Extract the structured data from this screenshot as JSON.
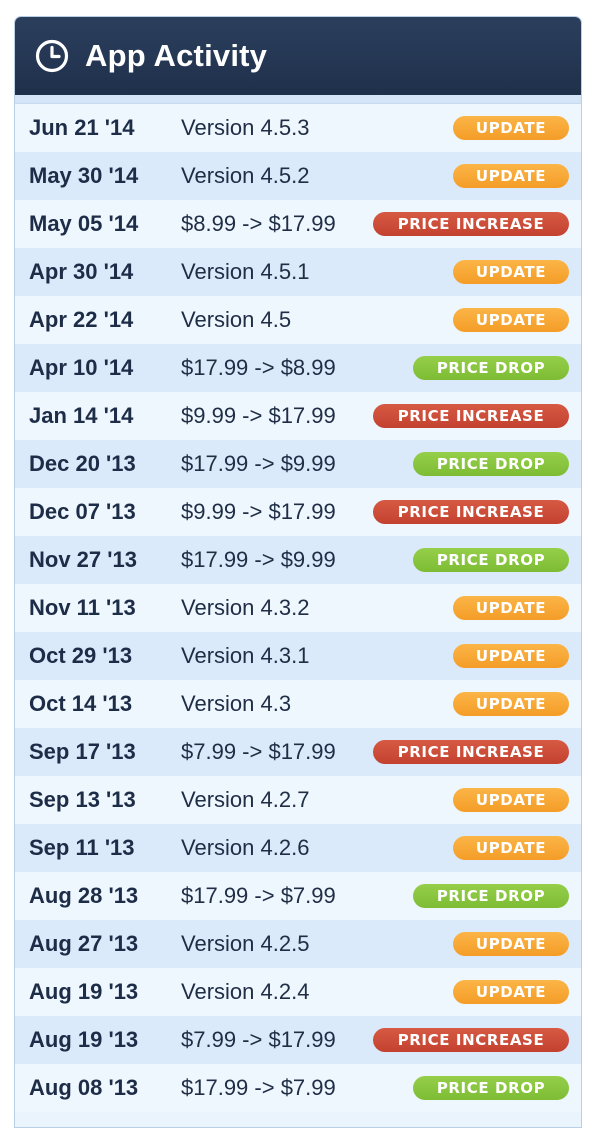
{
  "header": {
    "title": "App Activity",
    "icon": "clock-icon"
  },
  "colors": {
    "header_bg": "#233654",
    "update": "#f7a833",
    "price_increase": "#cc4c39",
    "price_drop": "#86c43d"
  },
  "activity": [
    {
      "date": "Jun 21 '14",
      "detail": "Version 4.5.3",
      "type": "update",
      "badge": "UPDATE"
    },
    {
      "date": "May 30 '14",
      "detail": "Version 4.5.2",
      "type": "update",
      "badge": "UPDATE"
    },
    {
      "date": "May 05 '14",
      "detail": "$8.99 -> $17.99",
      "type": "increase",
      "badge": "PRICE INCREASE"
    },
    {
      "date": "Apr 30 '14",
      "detail": "Version 4.5.1",
      "type": "update",
      "badge": "UPDATE"
    },
    {
      "date": "Apr 22 '14",
      "detail": "Version 4.5",
      "type": "update",
      "badge": "UPDATE"
    },
    {
      "date": "Apr 10 '14",
      "detail": "$17.99 -> $8.99",
      "type": "drop",
      "badge": "PRICE DROP"
    },
    {
      "date": "Jan 14 '14",
      "detail": "$9.99 -> $17.99",
      "type": "increase",
      "badge": "PRICE INCREASE"
    },
    {
      "date": "Dec 20 '13",
      "detail": "$17.99 -> $9.99",
      "type": "drop",
      "badge": "PRICE DROP"
    },
    {
      "date": "Dec 07 '13",
      "detail": "$9.99 -> $17.99",
      "type": "increase",
      "badge": "PRICE INCREASE"
    },
    {
      "date": "Nov 27 '13",
      "detail": "$17.99 -> $9.99",
      "type": "drop",
      "badge": "PRICE DROP"
    },
    {
      "date": "Nov 11 '13",
      "detail": "Version 4.3.2",
      "type": "update",
      "badge": "UPDATE"
    },
    {
      "date": "Oct 29 '13",
      "detail": "Version 4.3.1",
      "type": "update",
      "badge": "UPDATE"
    },
    {
      "date": "Oct 14 '13",
      "detail": "Version 4.3",
      "type": "update",
      "badge": "UPDATE"
    },
    {
      "date": "Sep 17 '13",
      "detail": "$7.99 -> $17.99",
      "type": "increase",
      "badge": "PRICE INCREASE"
    },
    {
      "date": "Sep 13 '13",
      "detail": "Version 4.2.7",
      "type": "update",
      "badge": "UPDATE"
    },
    {
      "date": "Sep 11 '13",
      "detail": "Version 4.2.6",
      "type": "update",
      "badge": "UPDATE"
    },
    {
      "date": "Aug 28 '13",
      "detail": "$17.99 -> $7.99",
      "type": "drop",
      "badge": "PRICE DROP"
    },
    {
      "date": "Aug 27 '13",
      "detail": "Version 4.2.5",
      "type": "update",
      "badge": "UPDATE"
    },
    {
      "date": "Aug 19 '13",
      "detail": "Version 4.2.4",
      "type": "update",
      "badge": "UPDATE"
    },
    {
      "date": "Aug 19 '13",
      "detail": "$7.99 -> $17.99",
      "type": "increase",
      "badge": "PRICE INCREASE"
    },
    {
      "date": "Aug 08 '13",
      "detail": "$17.99 -> $7.99",
      "type": "drop",
      "badge": "PRICE DROP"
    }
  ]
}
